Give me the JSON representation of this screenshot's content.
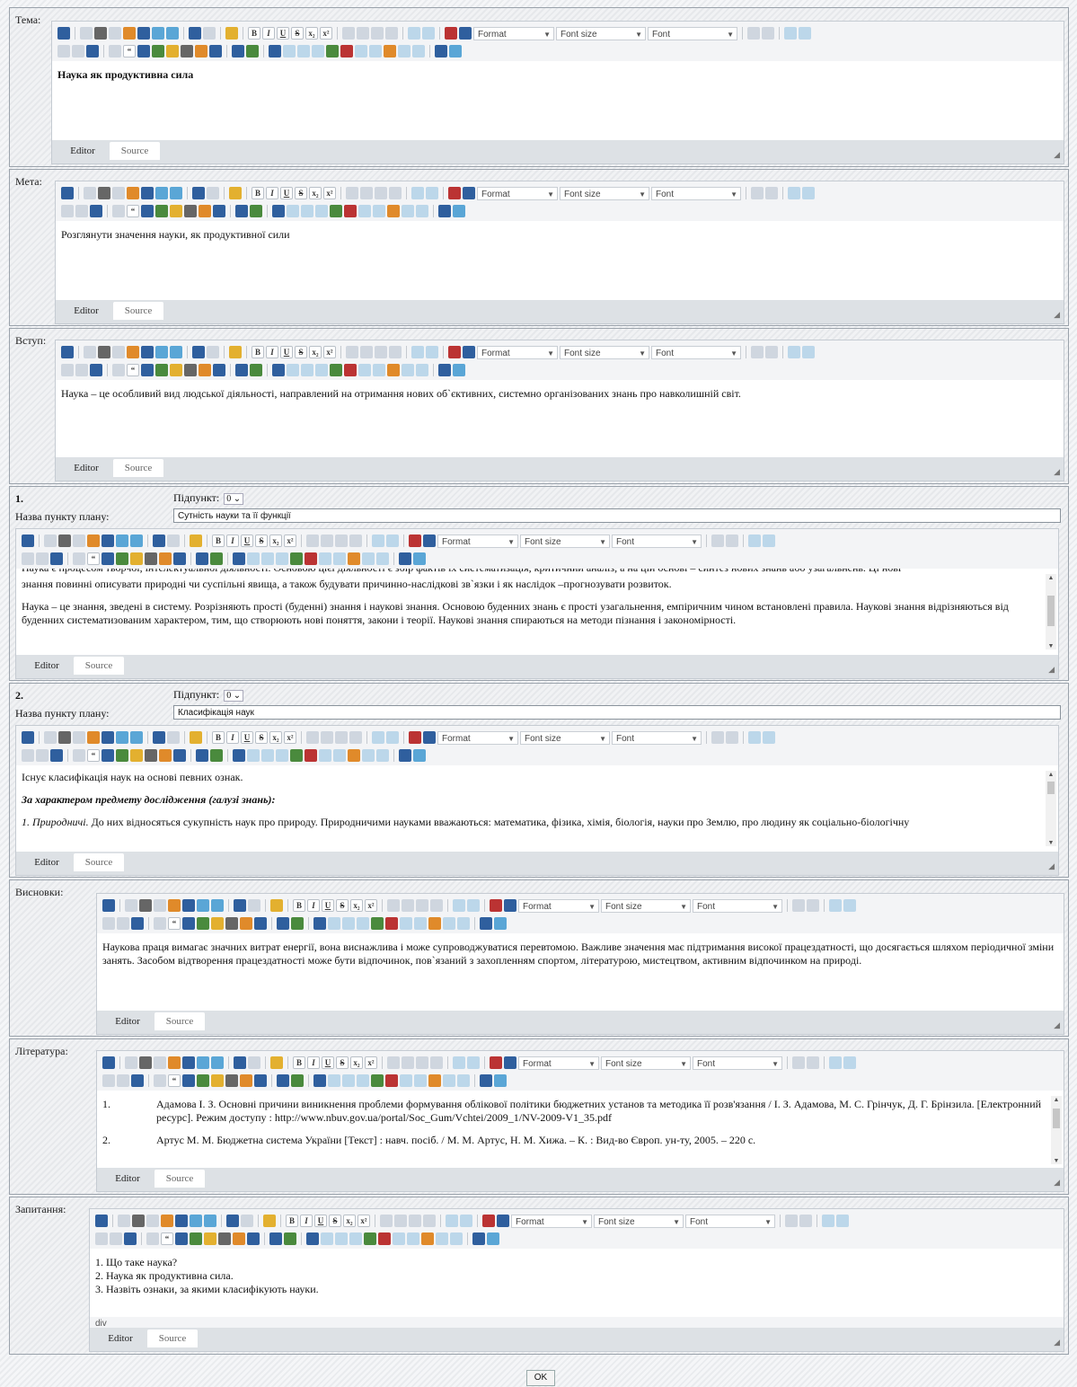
{
  "toolbar": {
    "format": "Format",
    "font_size": "Font size",
    "font": "Font"
  },
  "tabs": {
    "editor": "Editor",
    "source": "Source"
  },
  "sections": {
    "tema": {
      "label": "Тема:",
      "content": "Наука як продуктивна сила"
    },
    "meta": {
      "label": "Мета:",
      "content": "Розглянути значення науки, як продуктивної сили"
    },
    "vstup": {
      "label": "Вступ:",
      "content": "Наука – це особливий вид людської діяльності, направлений на отримання нових об`єктивних, системно організованих знань про навколишній світ."
    },
    "item1": {
      "num": "1.",
      "sub_label": "Підпункт:",
      "sub_value": "0",
      "name_label": "Назва пункту плану:",
      "name_value": "Сутність науки та її функції",
      "p0": "Наука є процесом творчої, інтелектуальної діяльності. Основою цієї діяльності є збір фактів їх систематизація, критичний аналіз, а на цій основі – синтез нових знань або узагальнень. Ці нові",
      "p1": "знання повинні описувати природні чи суспільні явища, а також будувати причинно-наслідкові зв`язки і як наслідок –прогнозувати розвиток.",
      "p2": "Наука – це знання, зведені в систему. Розрізняють прості (буденні) знання і наукові знання. Основою буденних знань є прості узагальнення, емпіричним чином встановлені правила. Наукові знання відрізняються від буденних систематизованим характером, тим, що створюють нові поняття, закони і теорії. Наукові знання спираються на методи пізнання і закономірності."
    },
    "item2": {
      "num": "2.",
      "sub_label": "Підпункт:",
      "sub_value": "0",
      "name_label": "Назва пункту плану:",
      "name_value": "Класифікація наук",
      "p1": "Існує класифікація наук на основі певних ознак.",
      "p2": "За характером предмету дослідження (галузі знань):",
      "p3a": "1. Природничі.",
      "p3b": " До них відносяться сукупність наук про природу. Природничими науками вважаються: математика, фізика, хімія, біологія, науки про Землю, про людину як соціально-біологічну"
    },
    "vysnovky": {
      "label": "Висновки:",
      "content": "Наукова праця вимагає значних витрат енергії, вона виснажлива і може супроводжуватися перевтомою. Важливе значення має підтримання високої працездатності, що досягається шляхом періодичної зміни занять. Засобом відтворення працездатності може бути відпочинок, пов`язаний з захопленням спортом, літературою, мистецтвом, активним відпочинком на природі."
    },
    "literatura": {
      "label": "Література:",
      "n1": "1.",
      "r1": "Адамова І. З. Основні причини виникнення проблеми формування облікової політики бюджетних установ та методика її розв'язання / І. З. Адамова, М. С. Грінчук, Д. Г. Брінзила. [Електронний ресурс]. Режим доступу : http://www.nbuv.gov.ua/portal/Soc_Gum/Vchtei/2009_1/NV-2009-V1_35.pdf",
      "n2": "2.",
      "r2": "Артус М. М. Бюджетна система України [Текст] : навч. посіб. / М. М. Артус, Н. М. Хижа. – К. : Вид-во Європ. ун-ту, 2005. – 220 с."
    },
    "zapytannia": {
      "label": "Запитання:",
      "q1": "1. Що таке наука?",
      "q2": "2. Наука як продуктивна сила.",
      "q3": "3. Назвіть ознаки, за якими класифікують науки.",
      "path": "div"
    }
  },
  "ok_label": "OK"
}
